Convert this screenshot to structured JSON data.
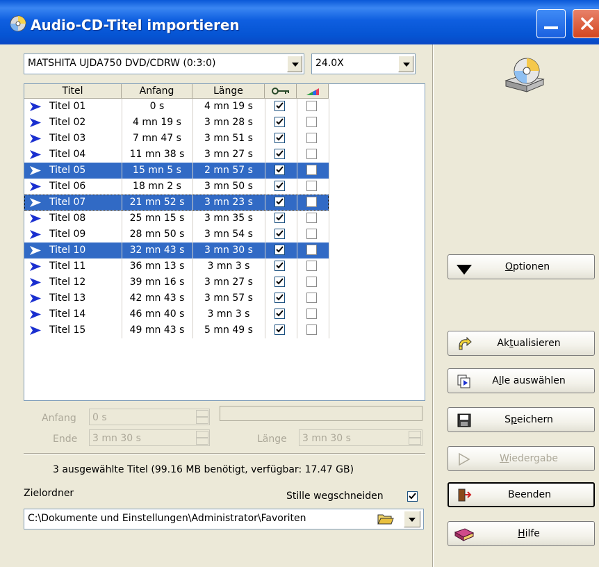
{
  "window": {
    "title": "Audio-CD-Titel importieren"
  },
  "drive": {
    "selected": "MATSHITA UJDA750 DVD/CDRW (0:3:0)"
  },
  "speed": {
    "selected": "24.0X"
  },
  "tracklist": {
    "columns": [
      "Titel",
      "Anfang",
      "Länge"
    ],
    "rows": [
      {
        "title": "Titel 01",
        "start": "0 s",
        "length": "4 mn 19 s",
        "checked": true,
        "selected": false
      },
      {
        "title": "Titel 02",
        "start": "4 mn 19 s",
        "length": "3 mn 28 s",
        "checked": true,
        "selected": false
      },
      {
        "title": "Titel 03",
        "start": "7 mn 47 s",
        "length": "3 mn 51 s",
        "checked": true,
        "selected": false
      },
      {
        "title": "Titel 04",
        "start": "11 mn 38 s",
        "length": "3 mn 27 s",
        "checked": true,
        "selected": false
      },
      {
        "title": "Titel 05",
        "start": "15 mn 5 s",
        "length": "2 mn 57 s",
        "checked": true,
        "selected": true
      },
      {
        "title": "Titel 06",
        "start": "18 mn 2 s",
        "length": "3 mn 50 s",
        "checked": true,
        "selected": false
      },
      {
        "title": "Titel 07",
        "start": "21 mn 52 s",
        "length": "3 mn 23 s",
        "checked": true,
        "selected": true,
        "focused": true
      },
      {
        "title": "Titel 08",
        "start": "25 mn 15 s",
        "length": "3 mn 35 s",
        "checked": true,
        "selected": false
      },
      {
        "title": "Titel 09",
        "start": "28 mn 50 s",
        "length": "3 mn 54 s",
        "checked": true,
        "selected": false
      },
      {
        "title": "Titel 10",
        "start": "32 mn 43 s",
        "length": "3 mn 30 s",
        "checked": true,
        "selected": true
      },
      {
        "title": "Titel 11",
        "start": "36 mn 13 s",
        "length": "3 mn 3 s",
        "checked": true,
        "selected": false
      },
      {
        "title": "Titel 12",
        "start": "39 mn 16 s",
        "length": "3 mn 27 s",
        "checked": true,
        "selected": false
      },
      {
        "title": "Titel 13",
        "start": "42 mn 43 s",
        "length": "3 mn 57 s",
        "checked": true,
        "selected": false
      },
      {
        "title": "Titel 14",
        "start": "46 mn 40 s",
        "length": "3 mn 3 s",
        "checked": true,
        "selected": false
      },
      {
        "title": "Titel 15",
        "start": "49 mn 43 s",
        "length": "5 mn 49 s",
        "checked": true,
        "selected": false
      }
    ]
  },
  "range": {
    "start_label": "Anfang",
    "start_value": "0 s",
    "end_label": "Ende",
    "end_value": "3 mn 30 s",
    "length_label": "Länge",
    "length_value": "3 mn 30 s"
  },
  "summary": "3 ausgewählte Titel (99.16 MB benötigt, verfügbar: 17.47 GB)",
  "target": {
    "label": "Zielordner",
    "silence_label": "Stille wegschneiden",
    "silence_checked": true,
    "path_part1": "C:\\Dokumente und Einstellungen",
    "path_part2": "\\Administrator",
    "path_part3": "\\Favoriten"
  },
  "buttons": {
    "options": "ptionen",
    "options_mnemonic": "O",
    "refresh_pre": "Ak",
    "refresh_mnemonic": "t",
    "refresh_post": "ualisieren",
    "select_all_pre": "A",
    "select_all_mnemonic": "l",
    "select_all_post": "le auswählen",
    "save_pre": "S",
    "save_mnemonic": "p",
    "save_post": "eichern",
    "play_mnemonic": "W",
    "play_post": "iedergabe",
    "exit": "Beenden",
    "help_mnemonic": "H",
    "help_post": "ilfe"
  },
  "colors": {
    "titlebar": "#0554d3",
    "selection": "#316AC5",
    "face": "#ECE9D8",
    "track_icon": "#1a2fd0"
  }
}
